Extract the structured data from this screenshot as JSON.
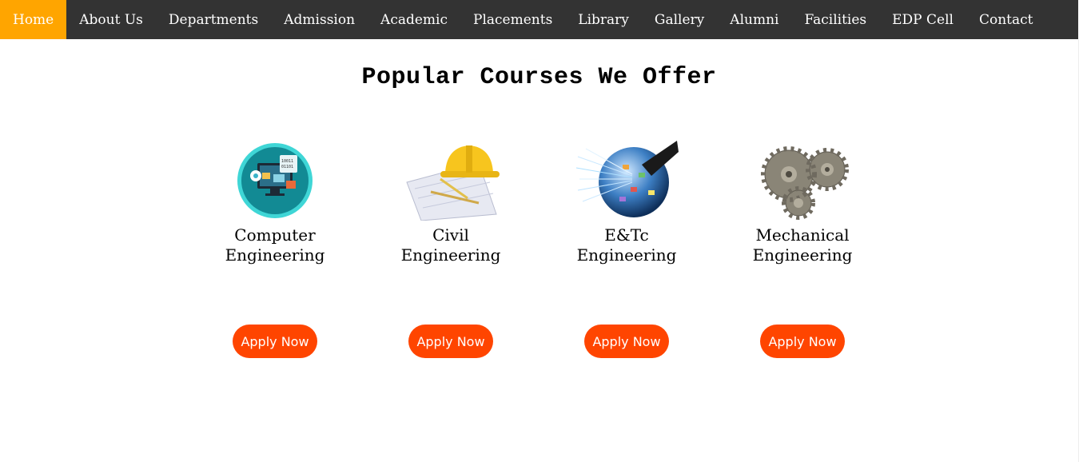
{
  "nav": {
    "items": [
      "Home",
      "About Us",
      "Departments",
      "Admission",
      "Academic",
      "Placements",
      "Library",
      "Gallery",
      "Alumni",
      "Facilities",
      "EDP Cell",
      "Contact"
    ],
    "active_index": 0,
    "active_color": "#ffa500",
    "bar_color": "#333333"
  },
  "section": {
    "title": "Popular Courses We Offer"
  },
  "courses": [
    {
      "line1": "Computer",
      "line2": "Engineering",
      "icon": "computer-engineering-icon",
      "apply": "Apply Now"
    },
    {
      "line1": "Civil",
      "line2": "Engineering",
      "icon": "hardhat-blueprint-icon",
      "apply": "Apply Now"
    },
    {
      "line1": "E&Tc",
      "line2": "Engineering",
      "icon": "fiber-globe-icon",
      "apply": "Apply Now"
    },
    {
      "line1": "Mechanical",
      "line2": "Engineering",
      "icon": "gears-icon",
      "apply": "Apply Now"
    }
  ],
  "colors": {
    "apply_button": "#ff4500"
  }
}
